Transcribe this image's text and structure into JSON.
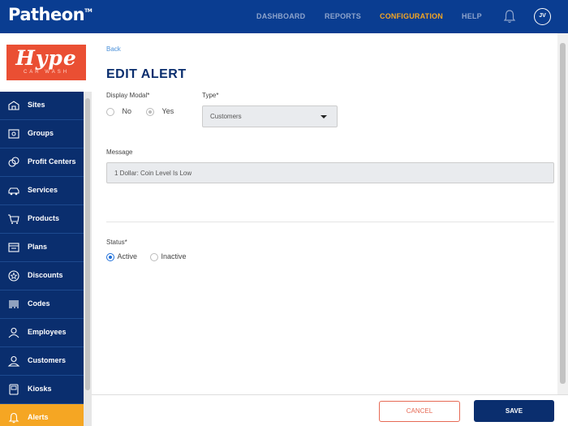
{
  "app": {
    "logo": "Patheon",
    "trademark": "TM"
  },
  "nav": {
    "items": [
      "DASHBOARD",
      "REPORTS",
      "CONFIGURATION",
      "HELP"
    ],
    "active": "CONFIGURATION"
  },
  "user": {
    "initials": "JV"
  },
  "brand": {
    "name": "Hype",
    "subtitle": "CAR WASH"
  },
  "sidebar": {
    "items": [
      {
        "label": "Sites",
        "icon": "sites-icon"
      },
      {
        "label": "Groups",
        "icon": "groups-icon"
      },
      {
        "label": "Profit Centers",
        "icon": "profit-centers-icon"
      },
      {
        "label": "Services",
        "icon": "car-icon"
      },
      {
        "label": "Products",
        "icon": "cart-icon"
      },
      {
        "label": "Plans",
        "icon": "plans-icon"
      },
      {
        "label": "Discounts",
        "icon": "discount-icon"
      },
      {
        "label": "Codes",
        "icon": "barcode-icon"
      },
      {
        "label": "Employees",
        "icon": "employee-icon"
      },
      {
        "label": "Customers",
        "icon": "customer-icon"
      },
      {
        "label": "Kiosks",
        "icon": "kiosk-icon"
      },
      {
        "label": "Alerts",
        "icon": "bell-icon"
      }
    ],
    "active": "Alerts"
  },
  "page": {
    "back": "Back",
    "title": "EDIT ALERT",
    "display_modal": {
      "label": "Display Modal*",
      "options": [
        "No",
        "Yes"
      ],
      "selected": "Yes"
    },
    "type": {
      "label": "Type*",
      "value": "Customers"
    },
    "message": {
      "label": "Message",
      "value": "1 Dollar: Coin Level Is Low"
    },
    "status": {
      "label": "Status*",
      "options": [
        "Active",
        "Inactive"
      ],
      "selected": "Active"
    }
  },
  "footer": {
    "cancel": "CANCEL",
    "save": "SAVE"
  },
  "colors": {
    "header": "#0a3d91",
    "sidebar": "#0a2e6e",
    "accent": "#f5a623",
    "cancel": "#e66a55",
    "brand": "#ea4f33"
  }
}
